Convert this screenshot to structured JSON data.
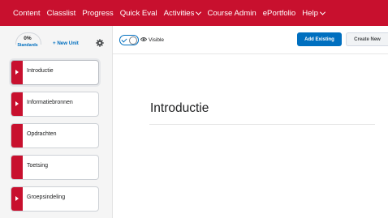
{
  "nav": {
    "items": [
      {
        "label": "Content",
        "dropdown": false
      },
      {
        "label": "Classlist",
        "dropdown": false
      },
      {
        "label": "Progress",
        "dropdown": false
      },
      {
        "label": "Quick Eval",
        "dropdown": false
      },
      {
        "label": "Activities",
        "dropdown": true
      },
      {
        "label": "Course Admin",
        "dropdown": false
      },
      {
        "label": "ePortfolio",
        "dropdown": false
      },
      {
        "label": "Help",
        "dropdown": true
      }
    ],
    "background": "#c8102e"
  },
  "sidebar": {
    "standards": {
      "percent": "0%",
      "label": "Standards"
    },
    "new_unit_label": "+ New Unit",
    "gear_icon": "gear-icon",
    "units": [
      {
        "label": "Introductie",
        "expandable": true,
        "active": true
      },
      {
        "label": "Informatiebronnen",
        "expandable": true,
        "active": false
      },
      {
        "label": "Opdrachten",
        "expandable": false,
        "active": false
      },
      {
        "label": "Toetsing",
        "expandable": false,
        "active": false
      },
      {
        "label": "Groepsindeling",
        "expandable": true,
        "active": false
      }
    ],
    "accent_color": "#c8102e"
  },
  "main": {
    "visibility_label": "Visible",
    "visibility_on": true,
    "add_existing_label": "Add Existing",
    "create_new_label": "Create New",
    "title": "Introductie"
  },
  "colors": {
    "primary_button": "#006fbf"
  }
}
